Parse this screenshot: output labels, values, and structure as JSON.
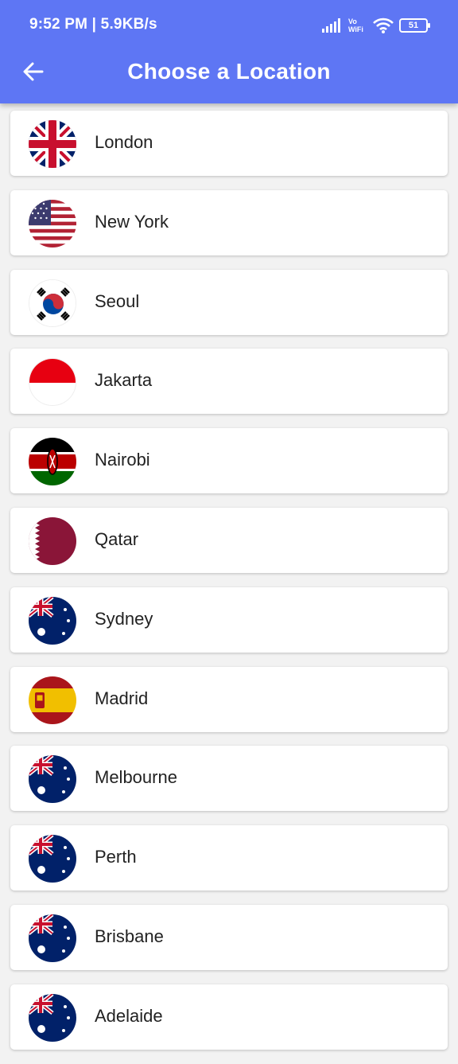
{
  "status_bar": {
    "time": "9:52 PM | 5.9KB/s",
    "battery": "51",
    "vowifi": "Vo WiFi"
  },
  "toolbar": {
    "title": "Choose a Location",
    "back_icon": "arrow-left-icon"
  },
  "colors": {
    "app_bar": "#5e76f4",
    "card": "#ffffff",
    "background": "#f2f2f2"
  },
  "locations": [
    {
      "name": "London",
      "flag": "uk"
    },
    {
      "name": "New York",
      "flag": "usa"
    },
    {
      "name": "Seoul",
      "flag": "south-korea"
    },
    {
      "name": "Jakarta",
      "flag": "indonesia"
    },
    {
      "name": "Nairobi",
      "flag": "kenya"
    },
    {
      "name": "Qatar",
      "flag": "qatar"
    },
    {
      "name": "Sydney",
      "flag": "australia"
    },
    {
      "name": "Madrid",
      "flag": "spain"
    },
    {
      "name": "Melbourne",
      "flag": "australia"
    },
    {
      "name": "Perth",
      "flag": "australia"
    },
    {
      "name": "Brisbane",
      "flag": "australia"
    },
    {
      "name": "Adelaide",
      "flag": "australia"
    }
  ]
}
